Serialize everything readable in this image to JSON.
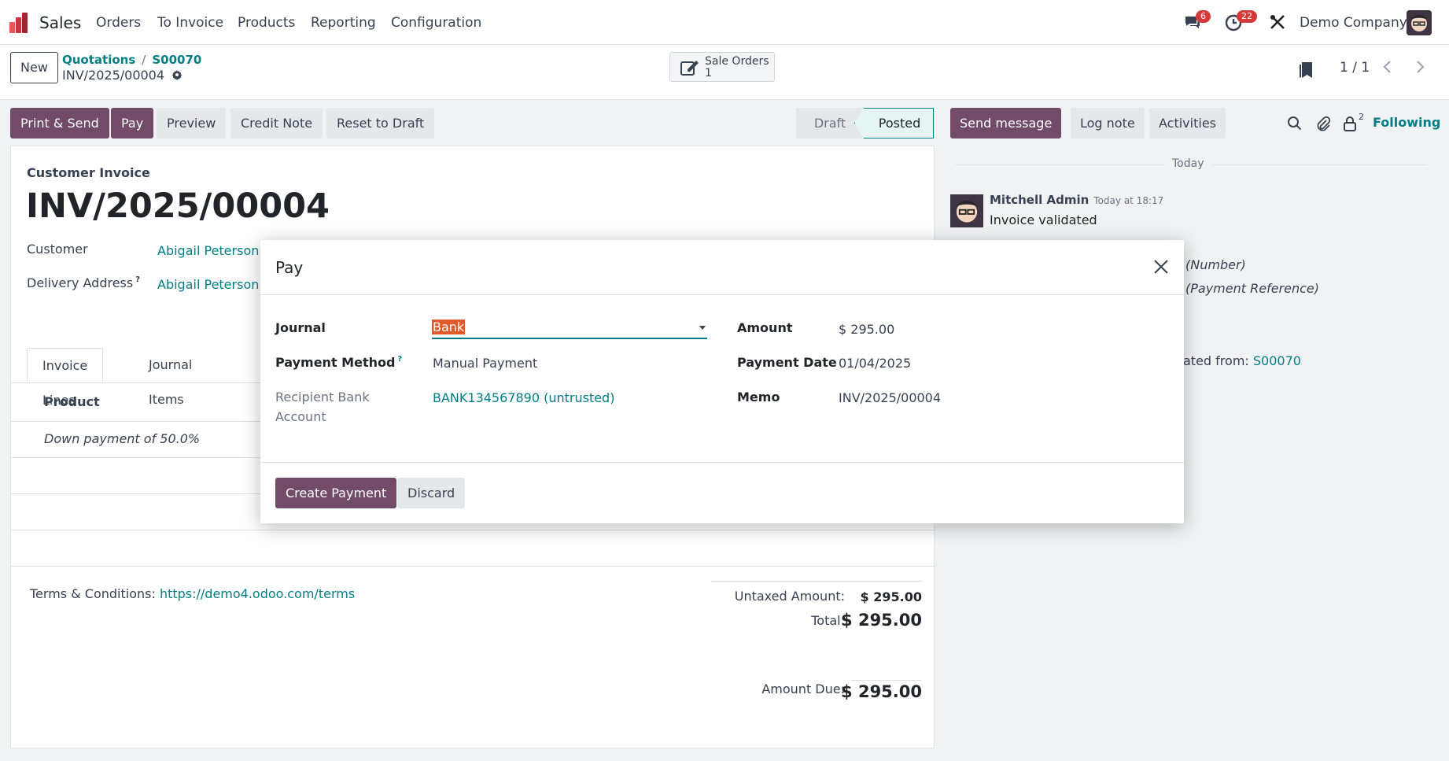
{
  "navbar": {
    "app_name": "Sales",
    "menu": [
      "Orders",
      "To Invoice",
      "Products",
      "Reporting",
      "Configuration"
    ],
    "messages_badge": "6",
    "activities_badge": "22",
    "company": "Demo Company"
  },
  "control_panel": {
    "new_label": "New",
    "breadcrumb": [
      "Quotations",
      "S00070"
    ],
    "breadcrumb_sep": "/",
    "current_record": "INV/2025/00004",
    "smart_button": {
      "label": "Sale Orders",
      "count": "1"
    },
    "pager": "1 / 1"
  },
  "action_buttons": {
    "print_send": "Print & Send",
    "pay": "Pay",
    "preview": "Preview",
    "credit_note": "Credit Note",
    "reset_to_draft": "Reset to Draft"
  },
  "status_bar": {
    "draft": "Draft",
    "posted": "Posted",
    "current": "Posted"
  },
  "form": {
    "doc_type": "Customer Invoice",
    "title": "INV/2025/00004",
    "customer_label": "Customer",
    "customer_value": "Abigail Peterson",
    "delivery_label": "Delivery Address",
    "delivery_value": "Abigail Peterson",
    "tabs": [
      "Invoice Lines",
      "Journal Items"
    ],
    "lines_header_product": "Product",
    "line_1": "Down payment of 50.0%",
    "terms_label": "Terms & Conditions:",
    "terms_link": "https://demo4.odoo.com/terms",
    "untaxed_label": "Untaxed Amount:",
    "untaxed_value": "$ 295.00",
    "total_label": "Total:",
    "total_value": "$ 295.00",
    "amount_due_label": "Amount Due:",
    "amount_due_value": "$ 295.00"
  },
  "chatter": {
    "send_message": "Send message",
    "log_note": "Log note",
    "activities": "Activities",
    "followers_count": "2",
    "following": "Following",
    "date_separator": "Today",
    "author": "Mitchell Admin",
    "time": "Today at 18:17",
    "message": "Invoice validated",
    "tracking_number": "(Number)",
    "tracking_payment_ref": "(Payment Reference)",
    "generated_from": "ated from:",
    "generated_link": "S00070"
  },
  "dialog": {
    "title": "Pay",
    "journal_label": "Journal",
    "journal_value": "Bank",
    "payment_method_label": "Payment Method",
    "payment_method_value": "Manual Payment",
    "recipient_bank_label": "Recipient Bank Account",
    "recipient_bank_value": "BANK134567890 (untrusted)",
    "amount_label": "Amount",
    "amount_value": "$ 295.00",
    "payment_date_label": "Payment Date",
    "payment_date_value": "01/04/2025",
    "memo_label": "Memo",
    "memo_value": "INV/2025/00004",
    "create_payment": "Create Payment",
    "discard": "Discard",
    "help_mark": "?"
  },
  "colors": {
    "brand": "#714b67",
    "link": "#017e84",
    "badge": "#d43a3a",
    "selection": "#e05a2a"
  }
}
